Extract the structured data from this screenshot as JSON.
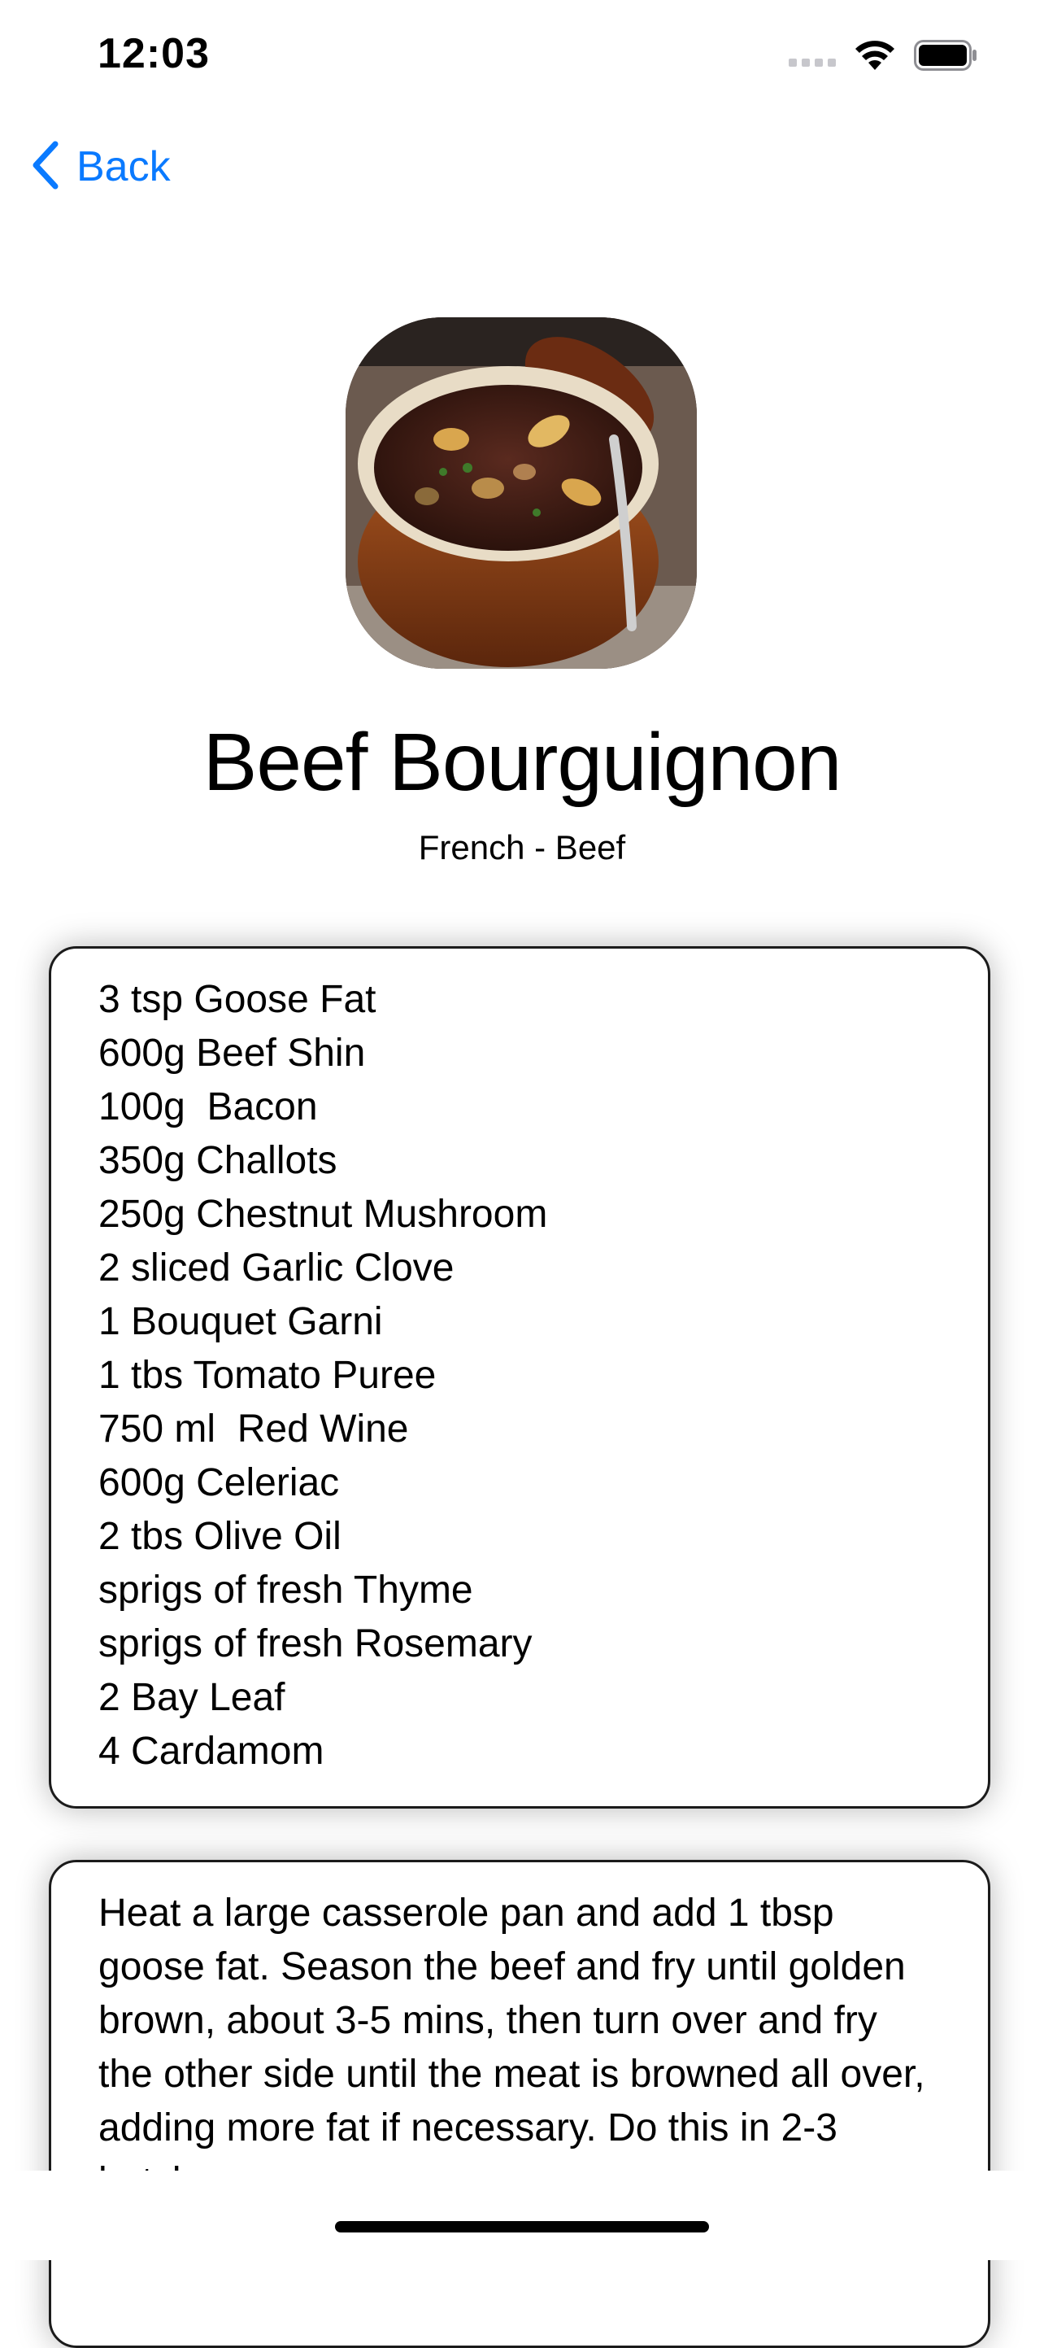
{
  "status_bar": {
    "time": "12:03",
    "icons": [
      "cellular-signal-icon",
      "wifi-icon",
      "battery-icon"
    ]
  },
  "nav": {
    "back_label": "Back",
    "back_icon": "chevron-left-icon",
    "accent_color": "#0a7aff"
  },
  "recipe": {
    "title": "Beef Bourguignon",
    "subtitle": "French - Beef",
    "ingredients": [
      "3 tsp Goose Fat",
      "600g Beef Shin",
      "100g  Bacon",
      "350g Challots",
      "250g Chestnut Mushroom",
      "2 sliced Garlic Clove",
      "1 Bouquet Garni",
      "1 tbs Tomato Puree",
      "750 ml  Red Wine",
      "600g Celeriac",
      "2 tbs Olive Oil",
      "sprigs of fresh Thyme",
      "sprigs of fresh Rosemary",
      "2 Bay Leaf",
      "4 Cardamom"
    ],
    "instructions": "Heat a large casserole pan and add 1 tbsp goose fat. Season the beef and fry until golden brown, about 3-5 mins, then turn over and fry the other side until the meat is browned all over, adding more fat if necessary. Do this in 2-3 batches"
  }
}
